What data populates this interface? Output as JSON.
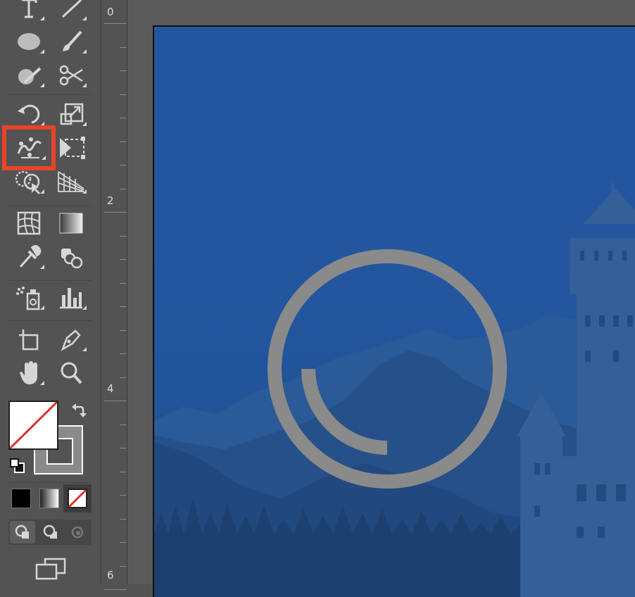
{
  "ruler": {
    "marks": [
      "0",
      "2",
      "4",
      "6"
    ]
  },
  "tools": [
    "type-tool",
    "line-segment-tool",
    "ellipse-tool",
    "paintbrush-tool",
    "shaper-tool",
    "scissors-tool",
    "rotate-tool",
    "scale-tool",
    "puppet-warp-tool",
    "free-transform-tool",
    "shape-builder-tool",
    "perspective-grid-tool",
    "mesh-tool",
    "gradient-tool",
    "eyedropper-tool",
    "blend-tool",
    "symbol-sprayer-tool",
    "column-graph-tool",
    "artboard-tool",
    "pen-tool",
    "hand-tool",
    "zoom-tool"
  ],
  "selected_tool": "puppet-warp-tool",
  "colors": {
    "highlight": "#e8432b",
    "artboard_blue": "#2257a0",
    "spinner": "#8a8a8a"
  },
  "fill_stroke": {
    "fill": "none",
    "stroke": "gray"
  },
  "color_modes": [
    "color",
    "gradient",
    "none"
  ],
  "draw_modes": [
    "draw-normal",
    "draw-behind",
    "draw-inside"
  ]
}
